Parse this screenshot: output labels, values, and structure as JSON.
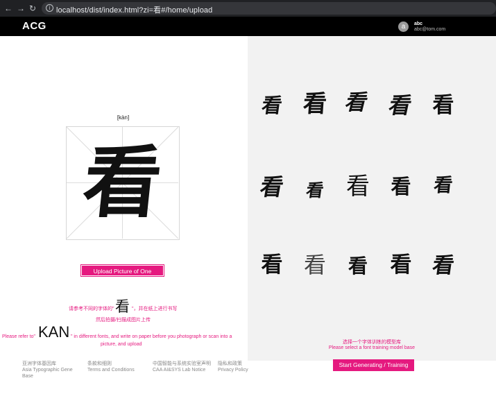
{
  "browser": {
    "back_icon": "arrow-left-icon",
    "forward_icon": "arrow-right-icon",
    "reload_icon": "reload-icon",
    "url": "localhost/dist/index.html?zi=看#/home/upload"
  },
  "header": {
    "brand": "ACG",
    "avatar_letter": "a",
    "user_name": "abc",
    "user_email": "abc@tom.com"
  },
  "character": {
    "pinyin": "[kàn]",
    "glyph": "看"
  },
  "upload": {
    "button_label": "Upload Picture of One Chinese"
  },
  "hints": {
    "cn_line1_prefix": "请参考不同的字体的\"",
    "cn_char": "看",
    "cn_line1_suffix": "\"，并在纸上进行书写",
    "cn_line2": "然后拍摄/扫描成图片上传",
    "en_line1_prefix": "Please refer to\"",
    "en_word": "KAN",
    "en_line1_suffix": "\" in different fonts, and write on paper before you photograph or scan into a",
    "en_line2": "picture, and upload"
  },
  "font_samples": {
    "glyphs": [
      "看",
      "看",
      "看",
      "看",
      "看",
      "看",
      "看",
      "看",
      "看",
      "看",
      "看",
      "看",
      "看",
      "看",
      "看"
    ]
  },
  "model_select": {
    "cn": "选择一个字体训练的模型库",
    "en": "Please select a font training model base"
  },
  "generate": {
    "button_label": "Start Generating / Training"
  },
  "footer": {
    "col1_cn": "亚洲字体基因库",
    "col1_en_line1": "Asia Typographic Gene",
    "col1_en_line2": "Base",
    "col2_cn": "条款和细则",
    "col2_en": "Terms and Conditions",
    "col3_cn": "中国智能与系统实验室声明",
    "col3_en": "CAA AI&SYS Lab Notice",
    "col4_cn": "隐私和政策",
    "col4_en": "Privacy Policy"
  },
  "colors": {
    "accent": "#e5197f",
    "topbar": "#000000",
    "panel": "#f2f2f2"
  }
}
